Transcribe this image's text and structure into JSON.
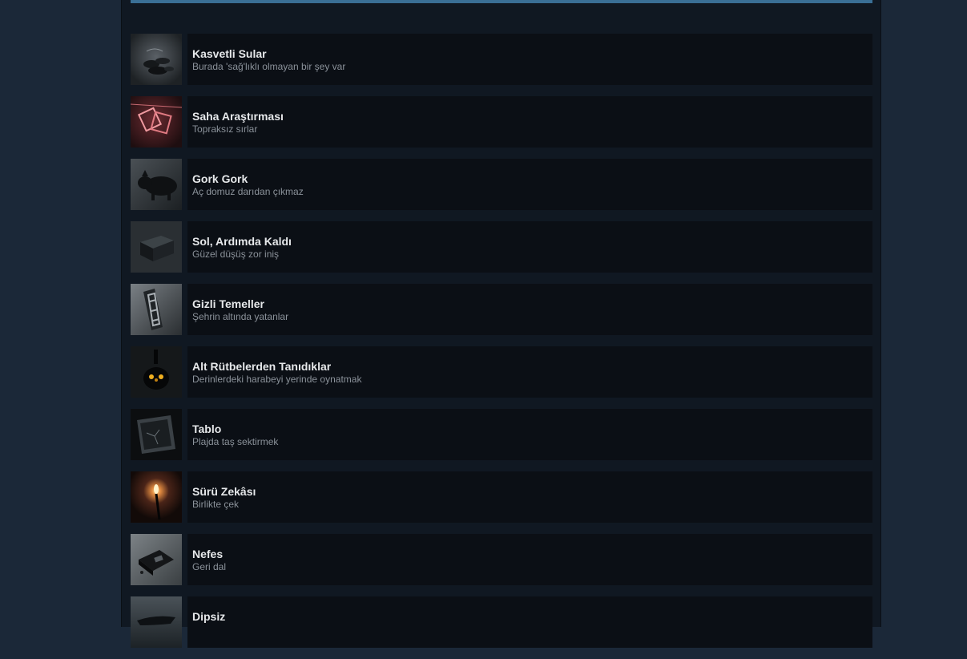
{
  "achievements": [
    {
      "title": "Kasvetli Sular",
      "description": "Burada 'sağ'lıklı olmayan bir şey var",
      "icon": "wet-stones-icon"
    },
    {
      "title": "Saha Araştırması",
      "description": "Topraksız sırlar",
      "icon": "hanging-photos-icon"
    },
    {
      "title": "Gork Gork",
      "description": "Aç domuz darıdan çıkmaz",
      "icon": "pig-icon"
    },
    {
      "title": "Sol, Ardımda Kaldı",
      "description": "Güzel düşüş zor iniş",
      "icon": "crate-icon"
    },
    {
      "title": "Gizli Temeller",
      "description": "Şehrin altında yatanlar",
      "icon": "letter-e-block-icon"
    },
    {
      "title": "Alt Rütbelerden Tanıdıklar",
      "description": "Derinlerdeki harabeyi yerinde oynatmak",
      "icon": "lantern-creature-icon"
    },
    {
      "title": "Tablo",
      "description": "Plajda taş sektirmek",
      "icon": "cracked-frame-icon"
    },
    {
      "title": "Sürü Zekâsı",
      "description": "Birlikte çek",
      "icon": "torch-icon"
    },
    {
      "title": "Nefes",
      "description": "Geri dal",
      "icon": "trap-device-icon"
    },
    {
      "title": "Dipsiz",
      "description": "",
      "icon": "sunken-boat-icon"
    }
  ]
}
